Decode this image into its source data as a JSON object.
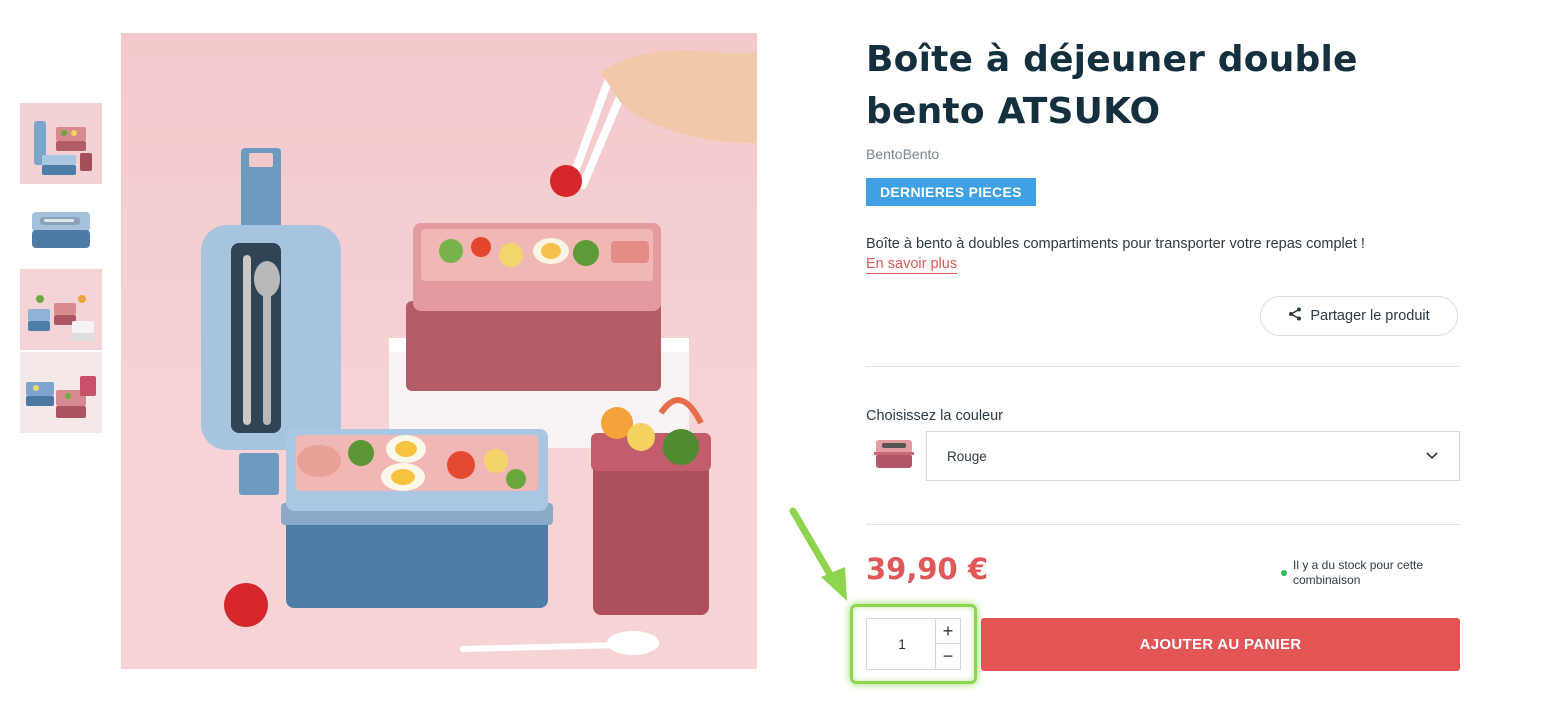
{
  "product": {
    "title": "Boîte à déjeuner double bento ATSUKO",
    "brand": "BentoBento",
    "badge": "DERNIERES PIECES",
    "description": "Boîte à bento à doubles compartiments pour transporter votre repas complet !",
    "more_link": "En savoir plus",
    "share_label": "Partager le produit",
    "price": "39,90 €",
    "stock_text": "Il y a du stock pour cette combinaison"
  },
  "variant": {
    "label": "Choisissez la couleur",
    "selected": "Rouge"
  },
  "cart": {
    "quantity": "1",
    "increment": "+",
    "decrement": "−",
    "add_label": "AJOUTER AU PANIER"
  },
  "colors": {
    "accent": "#e05757",
    "badge": "#3fa0e3",
    "title": "#14303f",
    "in_stock": "#2ebd59",
    "highlight": "#8ed44e"
  },
  "icons": [
    "share-icon",
    "chevron-down-icon",
    "annotation-arrow"
  ]
}
